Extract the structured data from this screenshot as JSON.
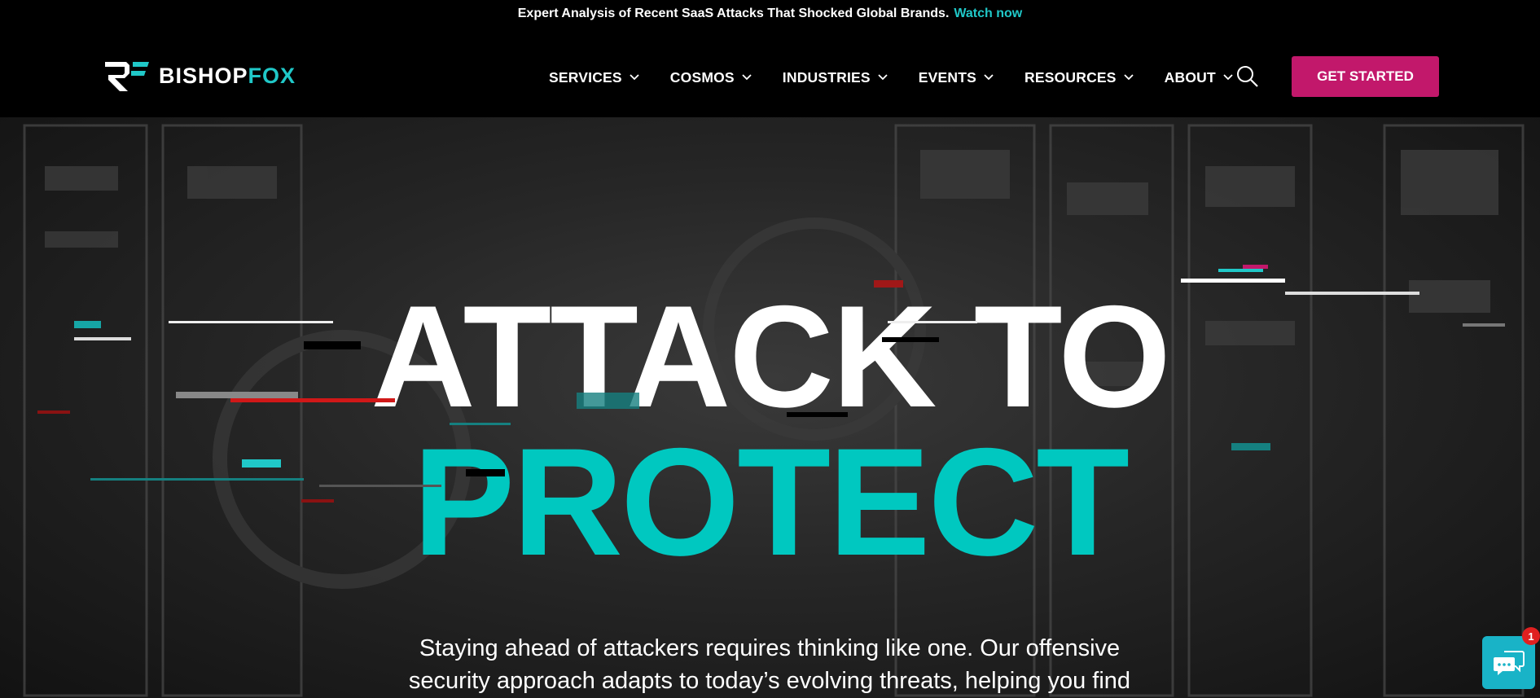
{
  "announcement": {
    "text": "Expert Analysis of Recent SaaS Attacks That Shocked Global Brands.",
    "link": "Watch now"
  },
  "header": {
    "logo": {
      "part1": "BISHOP",
      "part2": "FOX"
    },
    "nav": [
      {
        "label": "SERVICES"
      },
      {
        "label": "COSMOS"
      },
      {
        "label": "INDUSTRIES"
      },
      {
        "label": "EVENTS"
      },
      {
        "label": "RESOURCES"
      },
      {
        "label": "ABOUT"
      }
    ],
    "search_icon": "search-icon",
    "cta": "GET STARTED"
  },
  "hero": {
    "line1": "ATTACK TO",
    "line2": "PROTECT",
    "subtext_line1": "Staying ahead of attackers requires thinking like one. Our offensive",
    "subtext_line2": "security approach adapts to today’s evolving threats, helping you find"
  },
  "chat": {
    "icon": "chat-icon",
    "badge": "1"
  },
  "colors": {
    "accent_teal": "#20c8c8",
    "headline_teal": "#00c8c0",
    "cta_magenta": "#c2186b",
    "chat_bg": "#19b3c7",
    "badge_red": "#e02020"
  }
}
